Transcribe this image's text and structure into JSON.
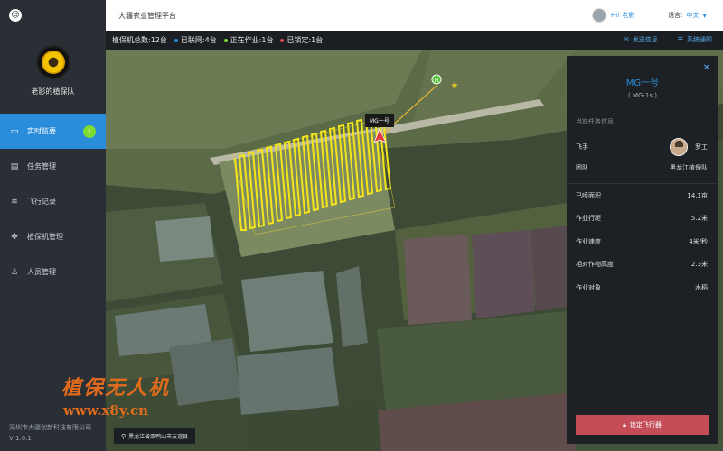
{
  "sidebar": {
    "team_name": "老影的植保队",
    "nav": [
      {
        "label": "实时监要",
        "icon": "monitor-icon",
        "active": true,
        "badge": "1"
      },
      {
        "label": "任务管理",
        "icon": "clipboard-icon"
      },
      {
        "label": "飞行记录",
        "icon": "wifi-icon"
      },
      {
        "label": "植保机管理",
        "icon": "drone-icon"
      },
      {
        "label": "人员管理",
        "icon": "person-icon"
      }
    ],
    "footer": [
      "深圳市大疆创新科技有限公司",
      "V 1.0.1"
    ]
  },
  "topbar": {
    "title": "大疆农业管理平台",
    "greeting": "Hi! 老影",
    "lang_label": "语言:",
    "lang_value": "中文"
  },
  "status": {
    "total": "植保机总数:12台",
    "connected": "已联网:4台",
    "working": "正在作业:1台",
    "locked": "已锁定:1台",
    "colors": {
      "connected": "#2a8ddb",
      "working": "#7fdc2f",
      "locked": "#e0454f"
    },
    "send_info": "发送信息",
    "system_notice": "系统通知"
  },
  "map": {
    "location": "黑龙江省双鸭山市友谊县",
    "drone_label": "MG一号"
  },
  "panel": {
    "name": "MG一号",
    "model": "( MG-1s )",
    "section": "当前任务信息",
    "pilot_label": "飞手",
    "pilot_name": "罗工",
    "team_label": "团队",
    "team_value": "黑龙江植保队",
    "stats": [
      {
        "label": "已喷面积",
        "value": "14.1亩"
      },
      {
        "label": "作业行距",
        "value": "5.2米"
      },
      {
        "label": "作业速度",
        "value": "4米/秒"
      },
      {
        "label": "相对作物高度",
        "value": "2.3米"
      },
      {
        "label": "作业对象",
        "value": "水稻"
      }
    ],
    "lock_button": "锁定飞行器"
  },
  "watermark": {
    "line1": "植保无人机",
    "line2": "www.x8y.cn"
  }
}
